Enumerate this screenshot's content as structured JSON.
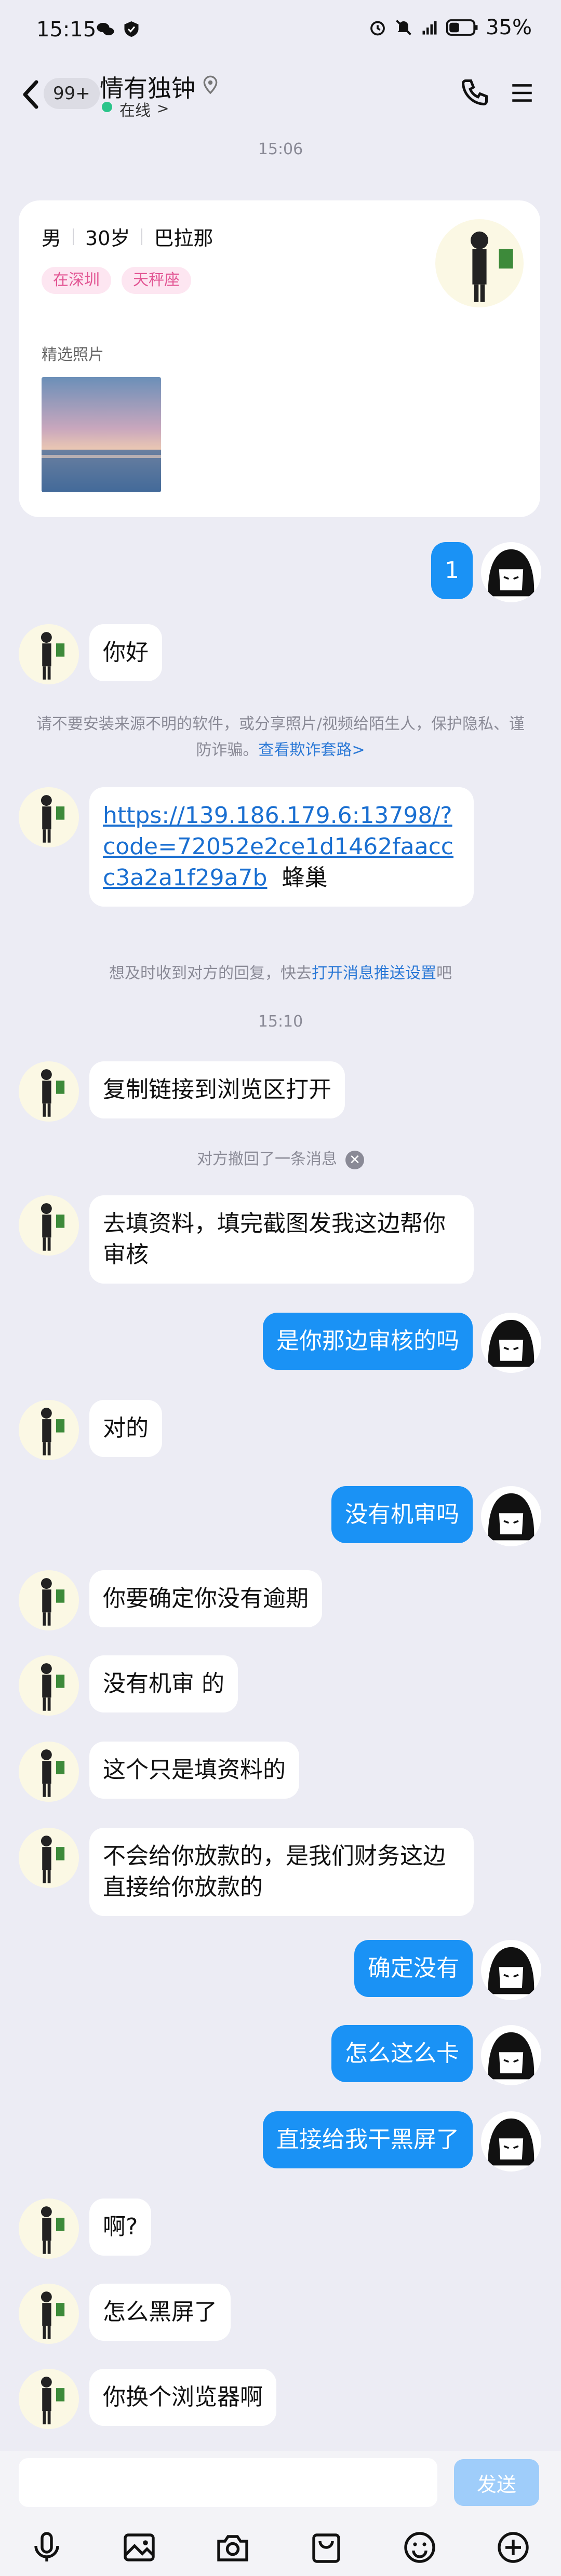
{
  "status": {
    "time": "15:15",
    "battery": "35%"
  },
  "header": {
    "unread": "99+",
    "name": "情有独钟",
    "online": "在线"
  },
  "timestamps": [
    "15:06",
    "15:10"
  ],
  "profile": {
    "gender": "男",
    "age": "30岁",
    "zodiac": "巴拉那",
    "tags": [
      "在深圳",
      "天秤座"
    ],
    "photos_label": "精选照片"
  },
  "messages": [
    {
      "from": "self",
      "text": "1"
    },
    {
      "from": "other",
      "text": "你好"
    },
    {
      "from": "other",
      "link": "https://139.186.179.6:13798/?code=72052e2ce1d1462faaccc3a2a1f29a7b",
      "suffix": "蜂巢"
    },
    {
      "from": "other",
      "text": "复制链接到浏览区打开"
    },
    {
      "from": "other",
      "text": "去填资料，填完截图发我这边帮你审核"
    },
    {
      "from": "self",
      "text": "是你那边审核的吗"
    },
    {
      "from": "other",
      "text": "对的"
    },
    {
      "from": "self",
      "text": "没有机审吗"
    },
    {
      "from": "other",
      "text": "你要确定你没有逾期"
    },
    {
      "from": "other",
      "text": "没有机审 的"
    },
    {
      "from": "other",
      "text": "这个只是填资料的"
    },
    {
      "from": "other",
      "text": "不会给你放款的，是我们财务这边直接给你放款的"
    },
    {
      "from": "self",
      "text": "确定没有"
    },
    {
      "from": "self",
      "text": "怎么这么卡"
    },
    {
      "from": "self",
      "text": "直接给我干黑屏了"
    },
    {
      "from": "other",
      "text": "啊?"
    },
    {
      "from": "other",
      "text": "怎么黑屏了"
    },
    {
      "from": "other",
      "text": "你换个浏览器啊"
    }
  ],
  "notices": {
    "safety_text": "请不要安装来源不明的软件，或分享照片/视频给陌生人，保护隐私、谨防诈骗。",
    "safety_link": "查看欺诈套路>",
    "push_text": "想及时收到对方的回复，快去",
    "push_link": "打开消息推送设置",
    "push_suffix": "吧",
    "recalled": "对方撤回了一条消息"
  },
  "input": {
    "placeholder": "",
    "send_label": "发送"
  },
  "colors": {
    "accent": "#1a92f5",
    "online": "#2bc48a",
    "tag": "#e25593"
  },
  "icons": [
    "mic-icon",
    "image-icon",
    "camera-icon",
    "bag-icon",
    "emoji-icon",
    "plus-icon"
  ]
}
